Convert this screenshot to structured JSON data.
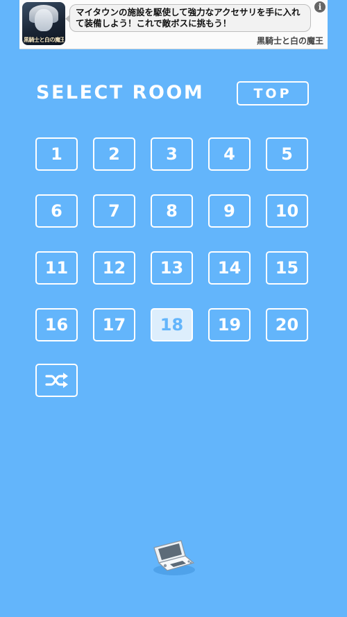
{
  "ad": {
    "thumbnail_text": "黒騎士と白の魔王",
    "message": "マイタウンの施設を駆使して強力なアクセサリを手に入れて装備しよう！これで敵ボスに挑もう！",
    "source": "黒騎士と白の魔王",
    "info_label": "i"
  },
  "header": {
    "title": "SELECT ROOM",
    "top_button": "TOP"
  },
  "rooms": [
    "1",
    "2",
    "3",
    "4",
    "5",
    "6",
    "7",
    "8",
    "9",
    "10",
    "11",
    "12",
    "13",
    "14",
    "15",
    "16",
    "17",
    "18",
    "19",
    "20"
  ],
  "current_room": "18",
  "icons": {
    "shuffle": "shuffle-icon",
    "device": "handheld-console-icon"
  },
  "colors": {
    "background": "#63b5fb",
    "current_room_fill": "#ddeefc"
  }
}
